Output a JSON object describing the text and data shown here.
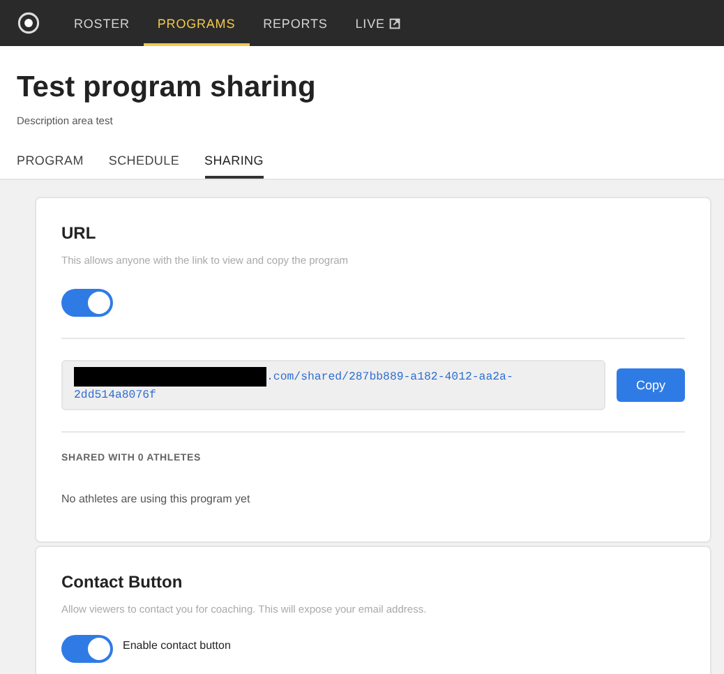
{
  "nav": {
    "items": [
      {
        "label": "ROSTER",
        "selected": false,
        "external": false
      },
      {
        "label": "PROGRAMS",
        "selected": true,
        "external": false
      },
      {
        "label": "REPORTS",
        "selected": false,
        "external": false
      },
      {
        "label": "LIVE",
        "selected": false,
        "external": true
      }
    ]
  },
  "page": {
    "title": "Test program sharing",
    "description": "Description area test"
  },
  "tabs": [
    {
      "label": "PROGRAM",
      "selected": false
    },
    {
      "label": "SCHEDULE",
      "selected": false
    },
    {
      "label": "SHARING",
      "selected": true
    }
  ],
  "url_card": {
    "title": "URL",
    "description": "This allows anyone with the link to view and copy the program",
    "toggle_on": true,
    "link": ".com/shared/287bb889-a182-4012-aa2a-2dd514a8076f",
    "copy_button": "Copy",
    "shared_heading": "SHARED WITH 0 ATHLETES",
    "empty_message": "No athletes are using this program yet"
  },
  "contact_card": {
    "title": "Contact Button",
    "description": "Allow viewers to contact you for coaching. This will expose your email address.",
    "toggle_on": true,
    "toggle_label": "Enable contact button"
  }
}
